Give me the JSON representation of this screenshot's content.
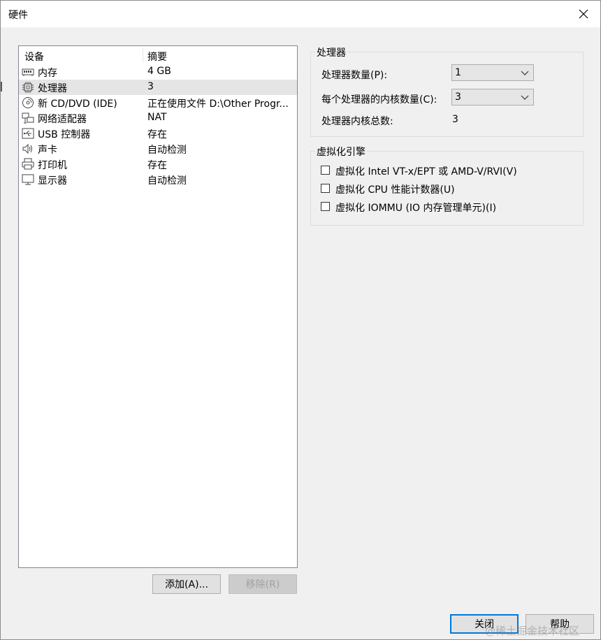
{
  "window": {
    "title": "硬件"
  },
  "device_list": {
    "headers": {
      "device": "设备",
      "summary": "摘要"
    },
    "rows": [
      {
        "name": "内存",
        "summary": "4 GB",
        "icon": "memory-icon"
      },
      {
        "name": "处理器",
        "summary": "3",
        "icon": "cpu-icon"
      },
      {
        "name": "新 CD/DVD (IDE)",
        "summary": "正在使用文件 D:\\Other Progr...",
        "icon": "cd-icon"
      },
      {
        "name": "网络适配器",
        "summary": "NAT",
        "icon": "network-icon"
      },
      {
        "name": "USB 控制器",
        "summary": "存在",
        "icon": "usb-icon"
      },
      {
        "name": "声卡",
        "summary": "自动检测",
        "icon": "speaker-icon"
      },
      {
        "name": "打印机",
        "summary": "存在",
        "icon": "printer-icon"
      },
      {
        "name": "显示器",
        "summary": "自动检测",
        "icon": "monitor-icon"
      }
    ],
    "selected_index": 1
  },
  "list_buttons": {
    "add": "添加(A)...",
    "remove": "移除(R)"
  },
  "processor_group": {
    "title": "处理器",
    "count_label": "处理器数量(P):",
    "count_value": "1",
    "cores_label": "每个处理器的内核数量(C):",
    "cores_value": "3",
    "total_label": "处理器内核总数:",
    "total_value": "3"
  },
  "virtualization_group": {
    "title": "虚拟化引擎",
    "options": [
      {
        "label": "虚拟化 Intel VT-x/EPT 或 AMD-V/RVI(V)",
        "checked": false
      },
      {
        "label": "虚拟化 CPU 性能计数器(U)",
        "checked": false
      },
      {
        "label": "虚拟化 IOMMU (IO 内存管理单元)(I)",
        "checked": false
      }
    ]
  },
  "footer": {
    "close": "关闭",
    "help": "帮助",
    "watermark": "@稀土掘金技术社区"
  },
  "colors": {
    "window_bg": "#f0f0f0",
    "selected_row": "#e5e5e5",
    "default_button_border": "#0078d7"
  }
}
